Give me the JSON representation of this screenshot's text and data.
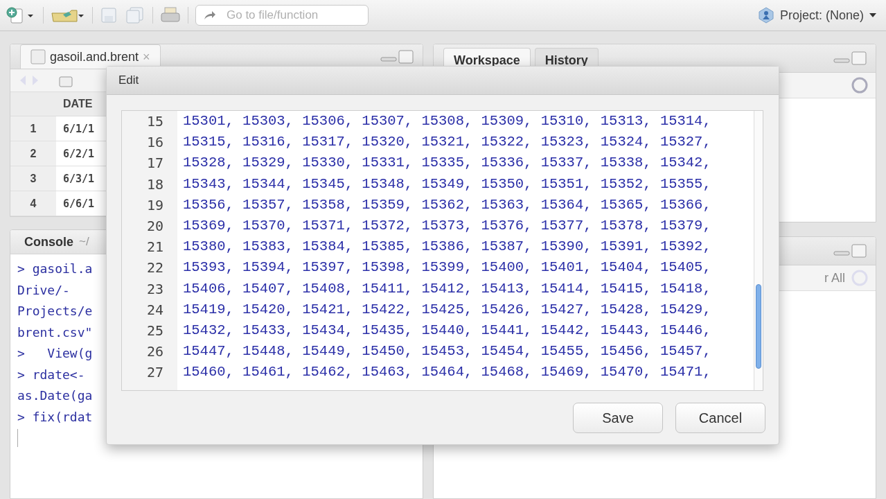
{
  "toolbar": {
    "goto": {
      "placeholder": "Go to file/function"
    },
    "project": "Project: (None)"
  },
  "source_pane": {
    "tabs": [
      {
        "label": "gasoil.and.brent",
        "close": "×",
        "selected": true
      }
    ],
    "table": {
      "columns": [
        "DATE"
      ],
      "rows": [
        {
          "index": "1",
          "cells": [
            "6/1/1"
          ]
        },
        {
          "index": "2",
          "cells": [
            "6/2/1"
          ]
        },
        {
          "index": "3",
          "cells": [
            "6/3/1"
          ]
        },
        {
          "index": "4",
          "cells": [
            "6/6/1"
          ]
        }
      ]
    }
  },
  "workspace_pane": {
    "tabs": [
      {
        "label": "Workspace",
        "selected": true
      },
      {
        "label": "History",
        "selected": false
      }
    ]
  },
  "console_pane": {
    "title": "Console",
    "path": "~/",
    "lines": [
      "> gasoil.a",
      "Drive/-",
      "Projects/e",
      "brent.csv\"",
      ">   View(g",
      "> rdate<-",
      "as.Date(ga",
      "> fix(rdat"
    ]
  },
  "files_pane": {
    "action": "r All"
  },
  "dialog": {
    "title": "Edit",
    "lines": [
      {
        "number": "15",
        "text": "15301, 15303, 15306, 15307, 15308, 15309, 15310, 15313, 15314,"
      },
      {
        "number": "16",
        "text": "15315, 15316, 15317, 15320, 15321, 15322, 15323, 15324, 15327,"
      },
      {
        "number": "17",
        "text": "15328, 15329, 15330, 15331, 15335, 15336, 15337, 15338, 15342,"
      },
      {
        "number": "18",
        "text": "15343, 15344, 15345, 15348, 15349, 15350, 15351, 15352, 15355,"
      },
      {
        "number": "19",
        "text": "15356, 15357, 15358, 15359, 15362, 15363, 15364, 15365, 15366,"
      },
      {
        "number": "20",
        "text": "15369, 15370, 15371, 15372, 15373, 15376, 15377, 15378, 15379,"
      },
      {
        "number": "21",
        "text": "15380, 15383, 15384, 15385, 15386, 15387, 15390, 15391, 15392,"
      },
      {
        "number": "22",
        "text": "15393, 15394, 15397, 15398, 15399, 15400, 15401, 15404, 15405,"
      },
      {
        "number": "23",
        "text": "15406, 15407, 15408, 15411, 15412, 15413, 15414, 15415, 15418,"
      },
      {
        "number": "24",
        "text": "15419, 15420, 15421, 15422, 15425, 15426, 15427, 15428, 15429,"
      },
      {
        "number": "25",
        "text": "15432, 15433, 15434, 15435, 15440, 15441, 15442, 15443, 15446,"
      },
      {
        "number": "26",
        "text": "15447, 15448, 15449, 15450, 15453, 15454, 15455, 15456, 15457,"
      },
      {
        "number": "27",
        "text": "15460, 15461, 15462, 15463, 15464, 15468, 15469, 15470, 15471,"
      }
    ],
    "buttons": [
      "Save",
      "Cancel"
    ]
  }
}
